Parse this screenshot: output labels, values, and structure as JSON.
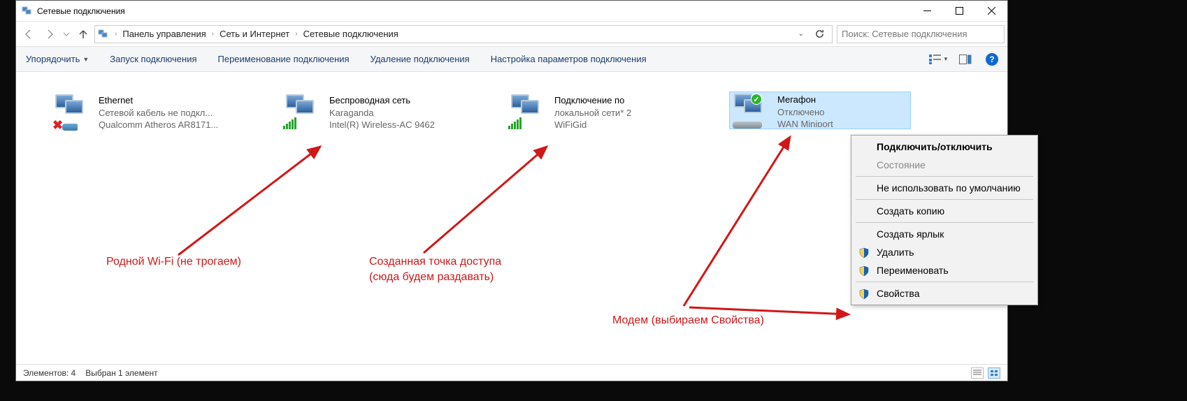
{
  "titlebar": {
    "title": "Сетевые подключения"
  },
  "breadcrumb": {
    "items": [
      "Панель управления",
      "Сеть и Интернет",
      "Сетевые подключения"
    ]
  },
  "search": {
    "placeholder": "Поиск: Сетевые подключения"
  },
  "cmdbar": {
    "organize": "Упорядочить",
    "start": "Запуск подключения",
    "rename": "Переименование подключения",
    "delete": "Удаление подключения",
    "config": "Настройка параметров подключения"
  },
  "connections": {
    "ethernet": {
      "name": "Ethernet",
      "line1": "Сетевой кабель не подкл...",
      "line2": "Qualcomm Atheros AR8171..."
    },
    "wifi": {
      "name": "Беспроводная сеть",
      "line1": "Karaganda",
      "line2": "Intel(R) Wireless-AC 9462"
    },
    "lan2": {
      "name": "Подключение по",
      "line1": "локальной сети* 2",
      "line2": "WiFiGid"
    },
    "megafon": {
      "name": "Мегафон",
      "line1": "Отключено",
      "line2": "WAN Miniport"
    }
  },
  "context_menu": {
    "connect": "Подключить/отключить",
    "status": "Состояние",
    "default": "Не использовать по умолчанию",
    "copy": "Создать копию",
    "shortcut": "Создать ярлык",
    "delete": "Удалить",
    "rename": "Переименовать",
    "properties": "Свойства"
  },
  "statusbar": {
    "count": "Элементов: 4",
    "selection": "Выбран 1 элемент"
  },
  "annotations": {
    "a1": "Родной Wi-Fi (не трогаем)",
    "a2_l1": "Созданная точка доступа",
    "a2_l2": "(сюда будем раздавать)",
    "a3": "Модем (выбираем Свойства)"
  }
}
